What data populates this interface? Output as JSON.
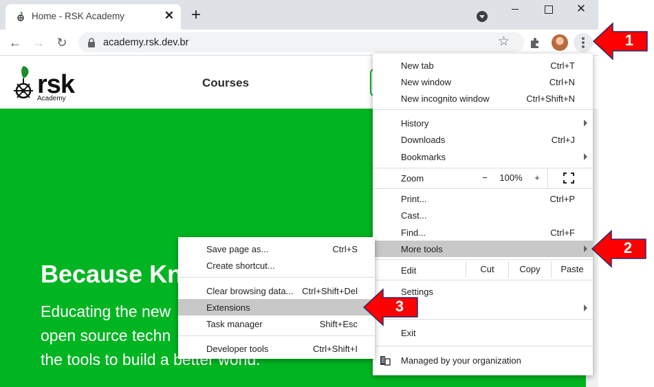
{
  "browser": {
    "tab": {
      "title": "Home - RSK Academy",
      "close": "✕"
    },
    "new_tab": "+",
    "window": {
      "close": "✕"
    },
    "nav": {
      "back": "←",
      "forward": "→",
      "reload": "↻"
    },
    "omnibox": {
      "url": "academy.rsk.dev.br"
    },
    "bookmark_star": "☆"
  },
  "site": {
    "logo_text": "rsk",
    "logo_sub": "Academy",
    "nav_courses": "Courses",
    "hero": {
      "title": "Because Kn",
      "line1": "Educating the new",
      "line2": "open source techn",
      "line3": "the tools to build a better world."
    }
  },
  "chrome_menu": {
    "new_tab": {
      "label": "New tab",
      "shortcut": "Ctrl+T"
    },
    "new_window": {
      "label": "New window",
      "shortcut": "Ctrl+N"
    },
    "new_incognito": {
      "label": "New incognito window",
      "shortcut": "Ctrl+Shift+N"
    },
    "history": {
      "label": "History"
    },
    "downloads": {
      "label": "Downloads",
      "shortcut": "Ctrl+J"
    },
    "bookmarks": {
      "label": "Bookmarks"
    },
    "zoom": {
      "label": "Zoom",
      "minus": "−",
      "value": "100%",
      "plus": "+"
    },
    "print": {
      "label": "Print...",
      "shortcut": "Ctrl+P"
    },
    "cast": {
      "label": "Cast..."
    },
    "find": {
      "label": "Find...",
      "shortcut": "Ctrl+F"
    },
    "more_tools": {
      "label": "More tools"
    },
    "edit": {
      "label": "Edit",
      "cut": "Cut",
      "copy": "Copy",
      "paste": "Paste"
    },
    "settings": {
      "label": "Settings"
    },
    "exit": {
      "label": "Exit"
    },
    "managed": {
      "label": "Managed by your organization"
    }
  },
  "more_tools_menu": {
    "save_page": {
      "label": "Save page as...",
      "shortcut": "Ctrl+S"
    },
    "create_shortcut": {
      "label": "Create shortcut..."
    },
    "clear_browsing": {
      "label": "Clear browsing data...",
      "shortcut": "Ctrl+Shift+Del"
    },
    "extensions": {
      "label": "Extensions"
    },
    "task_manager": {
      "label": "Task manager",
      "shortcut": "Shift+Esc"
    },
    "developer_tools": {
      "label": "Developer tools",
      "shortcut": "Ctrl+Shift+I"
    }
  },
  "callouts": {
    "one": "1",
    "two": "2",
    "three": "3"
  },
  "colors": {
    "hero_green": "#00b521",
    "callout_red": "#ff0000",
    "highlight": "#c8c8c8"
  },
  "icons": [
    "rsk-favicon-icon",
    "lock-icon",
    "star-icon",
    "puzzle-icon",
    "kebab-menu-icon",
    "fullscreen-icon",
    "building-icon",
    "chevron-right-icon"
  ]
}
